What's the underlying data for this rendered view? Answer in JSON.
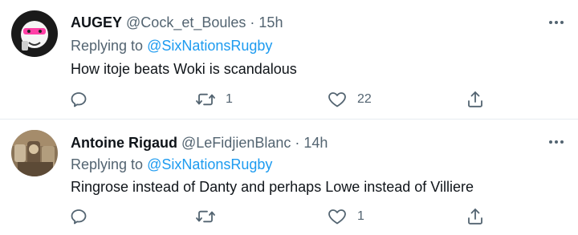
{
  "tweets": [
    {
      "author_name": "AUGEY",
      "author_handle": "@Cock_et_Boules",
      "separator": "·",
      "time": "15h",
      "replying_prefix": "Replying to",
      "replying_to": "@SixNationsRugby",
      "text": "How itoje beats Woki is scandalous",
      "retweets": "1",
      "likes": "22",
      "replies": ""
    },
    {
      "author_name": "Antoine Rigaud",
      "author_handle": "@LeFidjienBlanc",
      "separator": "·",
      "time": "14h",
      "replying_prefix": "Replying to",
      "replying_to": "@SixNationsRugby",
      "text": "Ringrose instead of Danty and perhaps Lowe instead of Villiere",
      "retweets": "",
      "likes": "1",
      "replies": ""
    }
  ],
  "colors": {
    "text_primary": "#0f1419",
    "text_secondary": "#536471",
    "link": "#1d9bf0",
    "divider": "#e6ecf0"
  },
  "icons": {
    "reply": "speech-bubble",
    "retweet": "retweet-arrows",
    "like": "heart-outline",
    "share": "upload-arrow",
    "more": "three-dots"
  }
}
